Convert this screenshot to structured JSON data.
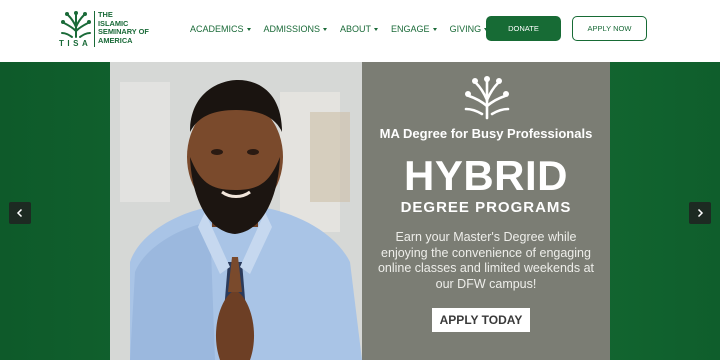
{
  "brand": {
    "name_lines": [
      "THE",
      "ISLAMIC",
      "SEMINARY OF",
      "AMERICA"
    ],
    "acronym": "TISA",
    "color": "#1a6a38"
  },
  "nav": {
    "items": [
      {
        "label": "ACADEMICS"
      },
      {
        "label": "ADMISSIONS"
      },
      {
        "label": "ABOUT"
      },
      {
        "label": "ENGAGE"
      },
      {
        "label": "GIVING"
      }
    ]
  },
  "header": {
    "donate_label": "DONATE",
    "apply_label": "APPLY NOW"
  },
  "hero": {
    "subtitle": "MA Degree for Busy Professionals",
    "headline": "HYBRID",
    "headline_sub": "DEGREE PROGRAMS",
    "body": "Earn your Master's Degree while enjoying the convenience of engaging online classes and limited weekends at our DFW campus!",
    "cta_label": "APPLY TODAY",
    "panel_color": "#7b7d74",
    "background_color": "#166f35"
  },
  "carousel": {
    "prev_icon": "chevron-left-icon",
    "next_icon": "chevron-right-icon"
  }
}
